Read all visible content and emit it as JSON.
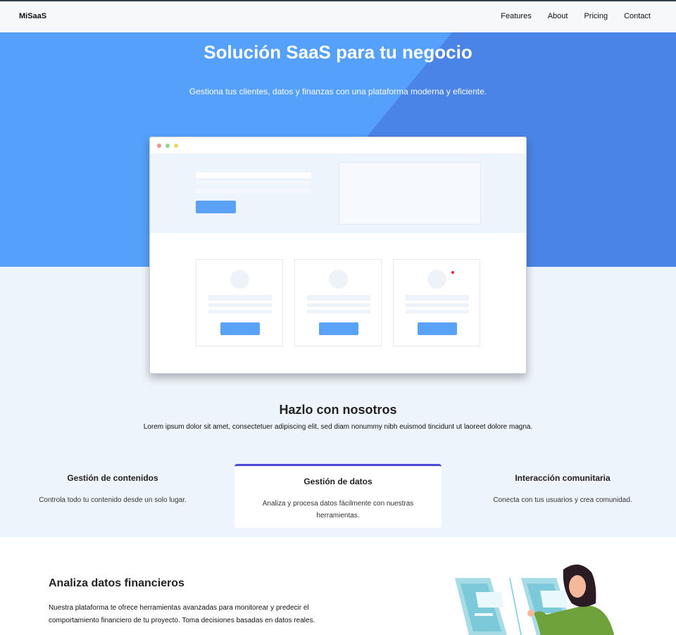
{
  "nav": {
    "brand": "MiSaaS",
    "links": [
      "Features",
      "About",
      "Pricing",
      "Contact"
    ]
  },
  "hero": {
    "title": "Solución SaaS para tu negocio",
    "subtitle": "Gestiona tus clientes, datos y finanzas con una plataforma moderna y eficiente."
  },
  "colors": {
    "hero_light": "#54a0fa",
    "hero_dark": "#4a84e6",
    "accent": "#4b49d8",
    "mock_button": "#5aa2f5",
    "page_bg": "#eef4fb"
  },
  "section": {
    "title": "Hazlo con nosotros",
    "lead": "Lorem ipsum dolor sit amet, consectetuer adipiscing elit, sed diam nonummy nibh euismod tincidunt ut laoreet dolore magna."
  },
  "features": [
    {
      "title": "Gestión de contenidos",
      "text": "Controla todo tu contenido desde un solo lugar."
    },
    {
      "title": "Gestión de datos",
      "text": "Analiza y procesa datos fácilmente con nuestras herramientas."
    },
    {
      "title": "Interacción comunitaria",
      "text": "Conecta con tus usuarios y crea comunidad."
    }
  ],
  "finance": {
    "title": "Analiza datos financieros",
    "text": "Nuestra plataforma te ofrece herramientas avanzadas para monitorear y predecir el comportamiento financiero de tu proyecto. Toma decisiones basadas en datos reales."
  }
}
